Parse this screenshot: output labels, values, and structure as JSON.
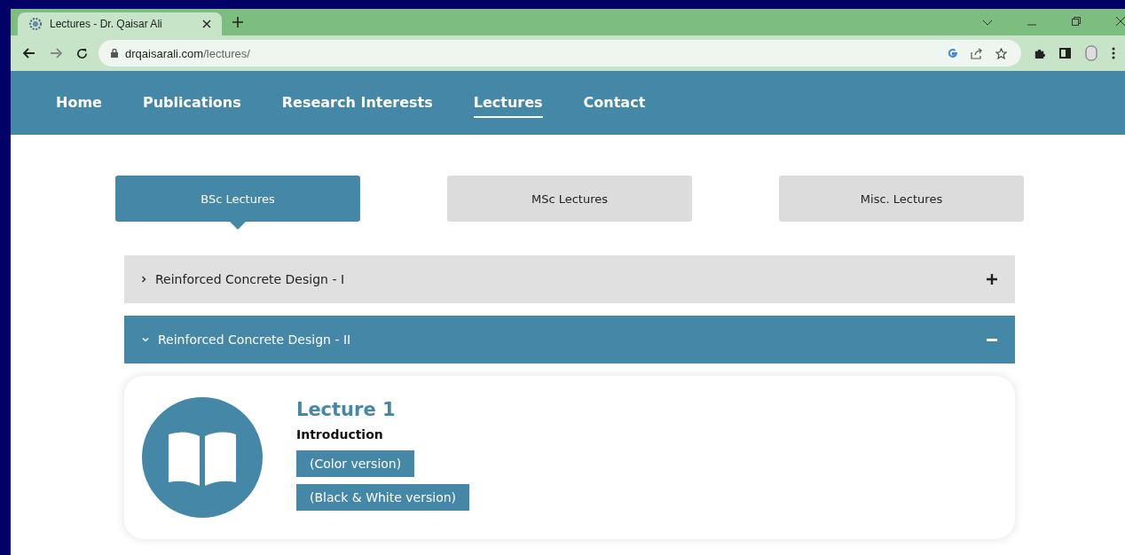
{
  "browser": {
    "tab_title": "Lectures - Dr. Qaisar Ali",
    "url_domain": "drqaisarali.com",
    "url_path": "/lectures/"
  },
  "nav": [
    {
      "label": "Home",
      "selected": false
    },
    {
      "label": "Publications",
      "selected": false
    },
    {
      "label": "Research Interests",
      "selected": false
    },
    {
      "label": "Lectures",
      "selected": true
    },
    {
      "label": "Contact",
      "selected": false
    }
  ],
  "lecture_tabs": [
    {
      "label": "BSc Lectures",
      "selected": true
    },
    {
      "label": "MSc Lectures",
      "selected": false
    },
    {
      "label": "Misc. Lectures",
      "selected": false
    }
  ],
  "courses": [
    {
      "title": "Reinforced Concrete Design - I",
      "expanded": false
    },
    {
      "title": "Reinforced Concrete Design - II",
      "expanded": true,
      "lectures": [
        {
          "title": "Lecture 1",
          "subtitle": "Introduction",
          "links": [
            "(Color version)",
            "(Black & White version)"
          ]
        }
      ]
    }
  ]
}
